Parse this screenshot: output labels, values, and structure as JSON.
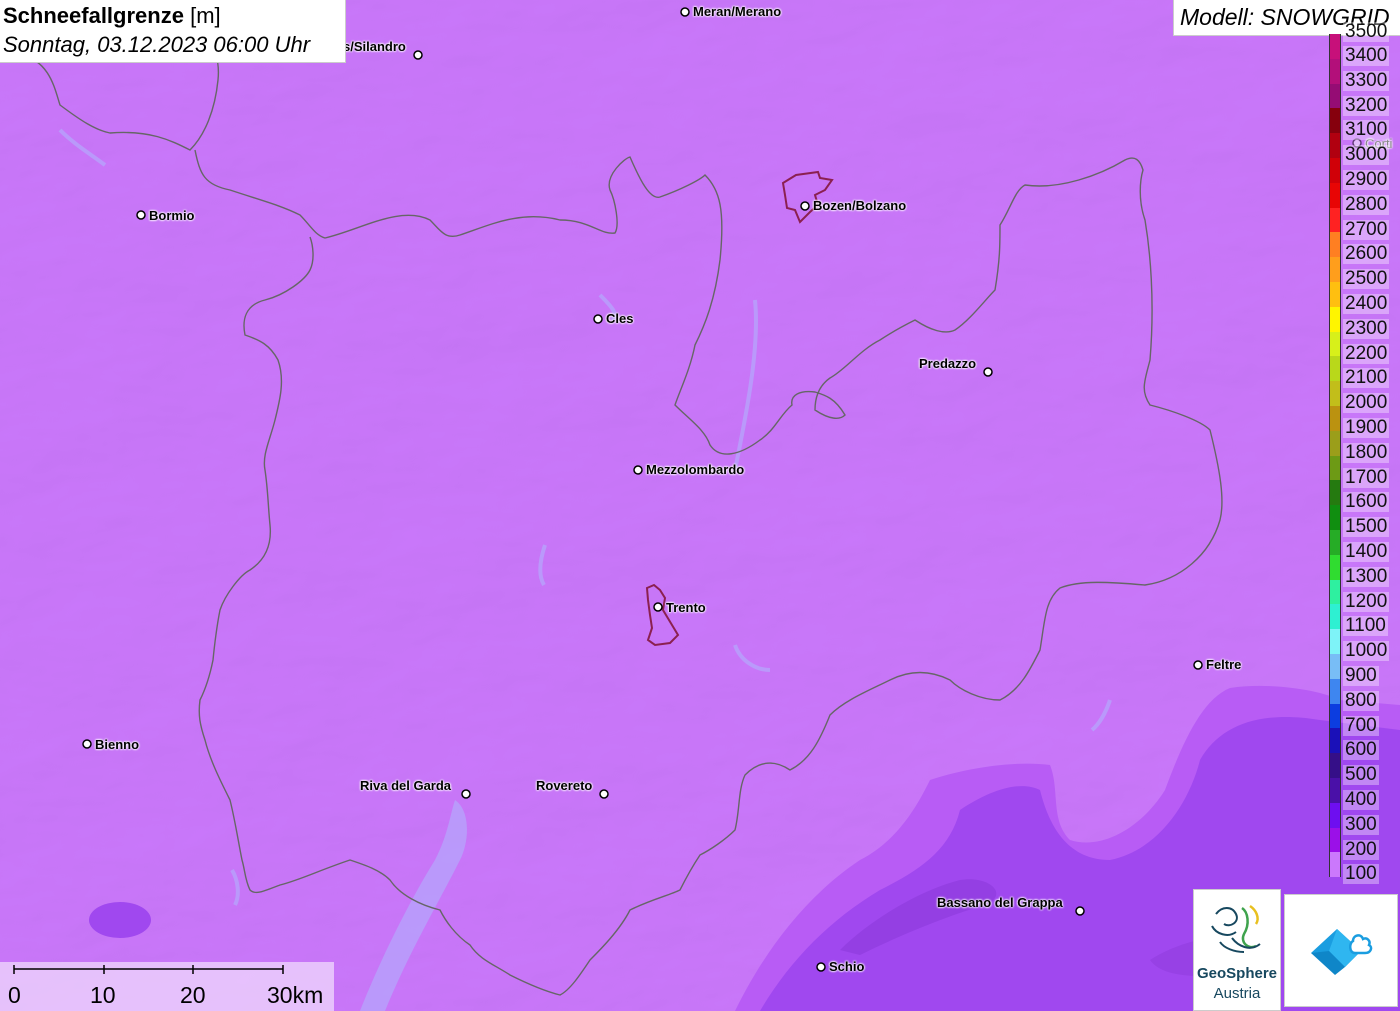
{
  "header": {
    "title_main": "Schneefallgrenze",
    "title_unit": "[m]",
    "subtitle": "Sonntag, 03.12.2023 06:00 Uhr"
  },
  "model": {
    "label": "Modell: SNOWGRID"
  },
  "cities": [
    {
      "name": "Meran/Merano"
    },
    {
      "name": "s/Silandro"
    },
    {
      "name": "Bormio"
    },
    {
      "name": "Bozen/Bolzano"
    },
    {
      "name": "Cles"
    },
    {
      "name": "Predazzo"
    },
    {
      "name": "Mezzolombardo"
    },
    {
      "name": "Trento"
    },
    {
      "name": "Feltre"
    },
    {
      "name": "Bienno"
    },
    {
      "name": "Riva del Garda"
    },
    {
      "name": "Rovereto"
    },
    {
      "name": "Bassano del Grappa"
    },
    {
      "name": "Schio"
    },
    {
      "name": "Corti"
    }
  ],
  "legend": {
    "unit": "m",
    "top_partial_label": "3500",
    "steps": [
      {
        "label": "3400",
        "color": "#c7107a"
      },
      {
        "label": "3300",
        "color": "#b30f7a"
      },
      {
        "label": "3200",
        "color": "#950c74"
      },
      {
        "label": "3100",
        "color": "#86000d"
      },
      {
        "label": "3000",
        "color": "#b10010"
      },
      {
        "label": "2900",
        "color": "#d00008"
      },
      {
        "label": "2800",
        "color": "#e80505"
      },
      {
        "label": "2700",
        "color": "#ff2222"
      },
      {
        "label": "2600",
        "color": "#ff7f22"
      },
      {
        "label": "2500",
        "color": "#ff9e1c"
      },
      {
        "label": "2400",
        "color": "#ffbf10"
      },
      {
        "label": "2300",
        "color": "#fff500"
      },
      {
        "label": "2200",
        "color": "#d7f01a"
      },
      {
        "label": "2100",
        "color": "#b9d81a"
      },
      {
        "label": "2000",
        "color": "#c2be1a"
      },
      {
        "label": "1900",
        "color": "#bb9210"
      },
      {
        "label": "1800",
        "color": "#9b9e1a"
      },
      {
        "label": "1700",
        "color": "#6d9a15"
      },
      {
        "label": "1600",
        "color": "#257a10"
      },
      {
        "label": "1500",
        "color": "#108e10"
      },
      {
        "label": "1400",
        "color": "#26ac26"
      },
      {
        "label": "1300",
        "color": "#30dc30"
      },
      {
        "label": "1200",
        "color": "#2ef0a0"
      },
      {
        "label": "1100",
        "color": "#2ef0d2"
      },
      {
        "label": "1000",
        "color": "#7ef3f8"
      },
      {
        "label": "900",
        "color": "#78bdf6"
      },
      {
        "label": "800",
        "color": "#3e86f0"
      },
      {
        "label": "700",
        "color": "#0c3de0"
      },
      {
        "label": "600",
        "color": "#1a10b8"
      },
      {
        "label": "500",
        "color": "#350f88"
      },
      {
        "label": "400",
        "color": "#4a10a8"
      },
      {
        "label": "300",
        "color": "#6e0ef0"
      },
      {
        "label": "200",
        "color": "#9b10e8"
      },
      {
        "label": "100",
        "color": "#cb78fc"
      }
    ]
  },
  "scalebar": {
    "labels": [
      "0",
      "10",
      "20",
      "30km"
    ]
  },
  "branding": {
    "org_line1": "GeoSphere",
    "org_line2": "Austria"
  },
  "colors": {
    "base_100m": "#cb78fc",
    "zone_200m": "#b85cf5",
    "zone_300m": "#a048ef",
    "zone_400m": "#8a38d8",
    "water": "#b6a3fb",
    "border": "#555555",
    "city_outline": "#8b2050"
  }
}
